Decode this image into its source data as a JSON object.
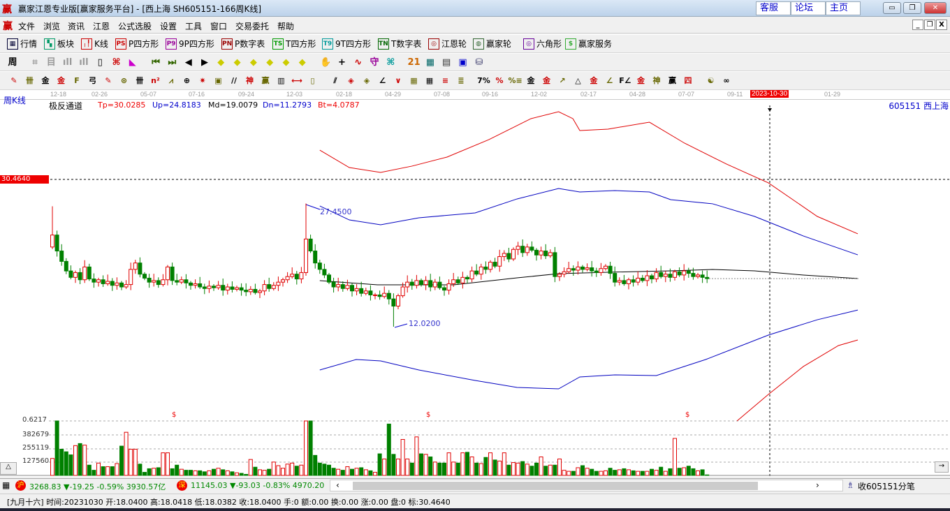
{
  "window": {
    "title": "赢家江恩专业版[赢家服务平台] - [西上海  SH605151-166周K线]",
    "logo": "赢",
    "links": [
      "客服",
      "论坛",
      "主页"
    ]
  },
  "menu": [
    "文件",
    "浏览",
    "资讯",
    "江恩",
    "公式选股",
    "设置",
    "工具",
    "窗口",
    "交易委托",
    "帮助"
  ],
  "toolbar1": [
    {
      "label": "行情",
      "glyph": "▦",
      "color": "#003"
    },
    {
      "label": "板块",
      "glyph": "▚",
      "color": "#096"
    },
    {
      "label": "K线",
      "glyph": "╷╿",
      "color": "#c00"
    },
    {
      "label": "P四方形",
      "glyph": "PS",
      "color": "#c00"
    },
    {
      "label": "9P四方形",
      "glyph": "P9",
      "color": "#909"
    },
    {
      "label": "P数字表",
      "glyph": "PN",
      "color": "#900"
    },
    {
      "label": "T四方形",
      "glyph": "TS",
      "color": "#090"
    },
    {
      "label": "9T四方形",
      "glyph": "T9",
      "color": "#099"
    },
    {
      "label": "T数字表",
      "glyph": "TN",
      "color": "#060"
    },
    {
      "label": "江恩轮",
      "glyph": "◎",
      "color": "#900"
    },
    {
      "label": "赢家轮",
      "glyph": "◍",
      "color": "#363"
    },
    {
      "label": "六角形",
      "glyph": "◎",
      "color": "#609"
    },
    {
      "label": "赢家服务",
      "glyph": "$",
      "color": "#3a3"
    }
  ],
  "toolbar2": {
    "period": "周",
    "icons": [
      "⌗",
      "目",
      "ıll",
      "ıll",
      "▯",
      "⌘",
      "◣",
      "⏮",
      "⏭",
      "◀",
      "▶",
      "◆",
      "◆",
      "◆",
      "◆",
      "◆",
      "◆",
      "✋",
      "+",
      "∿",
      "守",
      "⌘",
      "21",
      "▦",
      "▤",
      "▣",
      "⛁"
    ]
  },
  "toolbar3": {
    "icons": [
      "✎",
      "卌",
      "金",
      "金",
      "F",
      "弓",
      "✎",
      "⊛",
      "卌",
      "n²",
      "⩘",
      "⊕",
      "✷",
      "▣",
      "//",
      "神",
      "赢",
      "▥",
      "⟷",
      "▯",
      "⫽",
      "◈",
      "◈",
      "∠",
      "∨",
      "▦",
      "▦",
      "≡",
      "≣",
      "7%",
      "%",
      "%≡",
      "金",
      "金≡",
      "↗",
      "△",
      "金",
      "∠",
      "F∠",
      "金∠",
      "神∠",
      "赢∠",
      "四∠",
      "☯",
      "∞"
    ]
  },
  "chart": {
    "period_label": "周K线",
    "indicator": {
      "name": "极反通道",
      "tp": "Tp=30.0285",
      "up": "Up=24.8183",
      "md": "Md=19.0079",
      "dn": "Dn=11.2793",
      "bt": "Bt=4.0787"
    },
    "stock": "605151  西上海",
    "cursor_price": "30.4640",
    "high_label": "27.4500",
    "low_label": "12.0200",
    "dates": [
      "12-18",
      "02-26",
      "05-07",
      "07-16",
      "09-24",
      "12-03",
      "02-18",
      "04-29",
      "07-08",
      "09-16",
      "12-02",
      "02-17",
      "04-28",
      "07-07",
      "09-11",
      "2023-10-30",
      "01-29"
    ],
    "volume_ticks": [
      "0.6217",
      "382679",
      "255119",
      "127560"
    ],
    "dollar_marks": [
      "$",
      "$",
      "$"
    ]
  },
  "chart_data": {
    "type": "candlestick",
    "price_ref": {
      "top": 30.464,
      "bottom": 12.02
    },
    "closes": [
      23.5,
      21.5,
      20.2,
      19.0,
      18.2,
      18.8,
      17.9,
      19.5,
      18.0,
      17.6,
      17.9,
      17.4,
      17.7,
      17.2,
      17.5,
      17.0,
      17.3,
      19.2,
      20.0,
      18.6,
      18.1,
      17.6,
      17.8,
      17.3,
      17.9,
      19.5,
      17.8,
      17.6,
      17.9,
      17.5,
      17.2,
      17.4,
      17.0,
      16.8,
      17.1,
      16.9,
      17.2,
      16.6,
      17.0,
      16.7,
      16.9,
      16.6,
      16.4,
      16.7,
      16.3,
      16.5,
      17.3,
      16.8,
      17.2,
      17.6,
      17.9,
      18.3,
      18.6,
      18.0,
      18.8,
      23.0,
      21.5,
      20.0,
      19.2,
      18.5,
      17.6,
      17.0,
      17.3,
      16.8,
      17.2,
      16.5,
      16.8,
      16.2,
      16.5,
      16.0,
      16.0,
      15.8,
      16.2,
      15.5,
      14.6,
      15.9,
      17.0,
      17.6,
      17.2,
      17.8,
      17.3,
      17.8,
      17.0,
      17.6,
      16.9,
      16.6,
      17.4,
      17.9,
      17.5,
      18.2,
      18.0,
      19.0,
      18.6,
      19.5,
      19.2,
      20.1,
      19.6,
      20.8,
      21.2,
      20.5,
      21.7,
      22.1,
      21.3,
      22.0,
      21.6,
      21.0,
      21.5,
      20.9,
      21.3,
      18.3,
      18.6,
      18.9,
      19.3,
      19.1,
      19.5,
      19.2,
      19.4,
      19.0,
      18.8,
      19.3,
      19.6,
      18.7,
      17.6,
      17.8,
      17.4,
      17.9,
      17.6,
      18.1,
      17.8,
      18.4,
      18.0,
      18.8,
      18.3,
      18.6,
      18.2,
      18.9,
      18.5,
      19.0,
      18.7,
      18.3,
      18.5,
      18.2,
      18.04
    ],
    "volumes": [
      165,
      530,
      255,
      230,
      200,
      290,
      310,
      295,
      100,
      50,
      120,
      85,
      85,
      85,
      115,
      285,
      420,
      255,
      255,
      110,
      30,
      65,
      70,
      75,
      220,
      220,
      65,
      100,
      60,
      50,
      50,
      45,
      45,
      35,
      45,
      60,
      70,
      55,
      45,
      35,
      25,
      20,
      10,
      155,
      80,
      55,
      50,
      60,
      130,
      95,
      70,
      110,
      120,
      90,
      100,
      530,
      530,
      195,
      120,
      110,
      100,
      70,
      60,
      50,
      85,
      60,
      70,
      75,
      55,
      45,
      30,
      210,
      160,
      500,
      205,
      160,
      350,
      160,
      120,
      375,
      210,
      205,
      180,
      130,
      120,
      120,
      220,
      130,
      120,
      220,
      225,
      180,
      120,
      115,
      175,
      220,
      150,
      140,
      220,
      100,
      125,
      120,
      135,
      110,
      90,
      120,
      180,
      90,
      100,
      100,
      160,
      50,
      40,
      40,
      75,
      95,
      70,
      60,
      40,
      40,
      45,
      70,
      50,
      55,
      65,
      55,
      45,
      40,
      40,
      40,
      60,
      50,
      80,
      40,
      65,
      360,
      70,
      75,
      90,
      65,
      45,
      55,
      5
    ],
    "channel": {
      "upper_outer": [
        [
          58,
          34.13
        ],
        [
          64.4,
          31.95
        ],
        [
          71.2,
          31.34
        ],
        [
          78,
          32.13
        ],
        [
          85.6,
          33.26
        ],
        [
          94.7,
          35.45
        ],
        [
          103.8,
          38.07
        ],
        [
          109.8,
          38.94
        ],
        [
          112.9,
          38.07
        ],
        [
          114.4,
          36.58
        ],
        [
          120.5,
          36.76
        ],
        [
          129.5,
          37.63
        ],
        [
          137.1,
          35.01
        ],
        [
          146.2,
          32.39
        ],
        [
          155.3,
          30.03
        ],
        [
          165.9,
          25.83
        ],
        [
          174.7,
          23.65
        ]
      ],
      "upper_inner": [
        [
          58,
          27.14
        ],
        [
          64.4,
          25.39
        ],
        [
          71.2,
          24.78
        ],
        [
          79.5,
          25.66
        ],
        [
          91.7,
          26.27
        ],
        [
          100.8,
          28.02
        ],
        [
          109.8,
          29.33
        ],
        [
          114.4,
          28.89
        ],
        [
          122,
          29.07
        ],
        [
          129.5,
          28.89
        ],
        [
          134.1,
          27.93
        ],
        [
          143.2,
          27.41
        ],
        [
          152.3,
          25.83
        ],
        [
          162.9,
          23.38
        ],
        [
          174.7,
          21.02
        ]
      ],
      "middle": [
        [
          58,
          17.79
        ],
        [
          70.5,
          17.26
        ],
        [
          87.1,
          17.26
        ],
        [
          100.8,
          18.14
        ],
        [
          109.8,
          18.66
        ],
        [
          120.5,
          18.84
        ],
        [
          134.1,
          19.01
        ],
        [
          143.2,
          19.19
        ],
        [
          152.3,
          19.01
        ],
        [
          162.9,
          18.49
        ],
        [
          174.7,
          18.05
        ]
      ],
      "lower_inner": [
        [
          58,
          6.6
        ],
        [
          65.9,
          7.91
        ],
        [
          71.2,
          7.74
        ],
        [
          79.5,
          6.6
        ],
        [
          91.7,
          5.29
        ],
        [
          100.8,
          4.42
        ],
        [
          109.8,
          4.24
        ],
        [
          114.4,
          5.73
        ],
        [
          122,
          5.99
        ],
        [
          131,
          5.9
        ],
        [
          141.7,
          7.91
        ],
        [
          155.3,
          10.97
        ],
        [
          165.9,
          12.89
        ],
        [
          174.7,
          14.11
        ]
      ],
      "lower_outer": [
        [
          148.5,
          0.22
        ],
        [
          155.3,
          3.54
        ],
        [
          162.9,
          7.04
        ],
        [
          170.5,
          9.66
        ],
        [
          174.7,
          10.36
        ]
      ]
    },
    "colors": {
      "up": "#e00000",
      "down": "#008000",
      "upper_outer": "#e00000",
      "inner": "#0000c0",
      "middle": "#000000"
    }
  },
  "index_bar": {
    "sh_badge": "沪",
    "sh": "3268.83 ▼-19.25 -0.59% 3930.57亿",
    "sz_badge": "深",
    "sz": "11145.03 ▼-93.03 -0.83% 4970.20",
    "right": "收605151分笔"
  },
  "status": "[九月十六] 时间:20231030 开:18.0400 高:18.0418 低:18.0382 收:18.0400 手:0 额:0.00 换:0.00 涨:0.00 盘:0 标:30.4640"
}
